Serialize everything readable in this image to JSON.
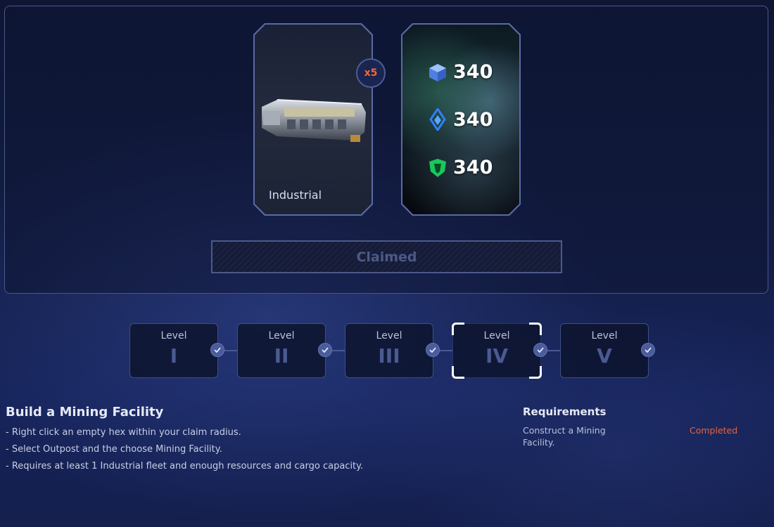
{
  "reward": {
    "fleet_card": {
      "label": "Industrial",
      "multiplier": "x5"
    },
    "resources": [
      {
        "icon": "blue-cube-icon",
        "amount": "340",
        "color": "#5b8ef0"
      },
      {
        "icon": "blue-crystal-icon",
        "amount": "340",
        "color": "#2f7fff"
      },
      {
        "icon": "green-shield-icon",
        "amount": "340",
        "color": "#2fd46a"
      }
    ],
    "claim_button": "Claimed"
  },
  "levels": [
    {
      "caption": "Level",
      "numeral": "I",
      "completed": true
    },
    {
      "caption": "Level",
      "numeral": "II",
      "completed": true
    },
    {
      "caption": "Level",
      "numeral": "III",
      "completed": true
    },
    {
      "caption": "Level",
      "numeral": "IV",
      "completed": true,
      "current": true
    },
    {
      "caption": "Level",
      "numeral": "V",
      "completed": true
    }
  ],
  "mission": {
    "title": "Build a Mining Facility",
    "steps": [
      "- Right click an empty hex within your claim radius.",
      "- Select Outpost and the choose Mining Facility.",
      "- Requires at least 1 Industrial fleet and enough resources and cargo capacity."
    ]
  },
  "requirements": {
    "heading": "Requirements",
    "text": "Construct a Mining Facility.",
    "status": "Completed",
    "status_color": "#e8643a"
  }
}
